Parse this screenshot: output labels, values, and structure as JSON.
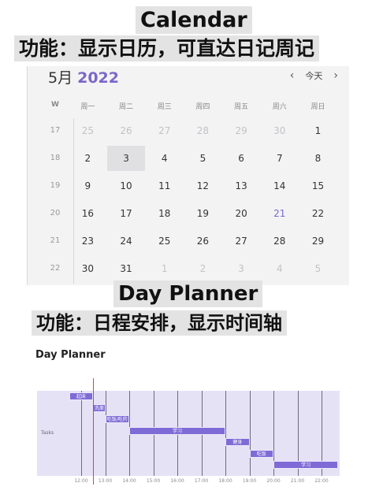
{
  "captions": {
    "title": "Calendar",
    "subtitle": "功能：显示日历，可直达日记周记",
    "title2": "Day Planner",
    "subtitle2": "功能：日程安排，显示时间轴"
  },
  "calendar": {
    "month": "5月",
    "year": "2022",
    "nav": {
      "prev": "‹",
      "today": "今天",
      "next": "›"
    },
    "headers": [
      "W",
      "周一",
      "周二",
      "周三",
      "周四",
      "周五",
      "周六",
      "周日"
    ],
    "rows": [
      {
        "week": "17",
        "days": [
          {
            "d": "25",
            "dim": true
          },
          {
            "d": "26",
            "dim": true
          },
          {
            "d": "27",
            "dim": true
          },
          {
            "d": "28",
            "dim": true
          },
          {
            "d": "29",
            "dim": true
          },
          {
            "d": "30",
            "dim": true
          },
          {
            "d": "1"
          }
        ]
      },
      {
        "week": "18",
        "days": [
          {
            "d": "2"
          },
          {
            "d": "3",
            "sel": true
          },
          {
            "d": "4"
          },
          {
            "d": "5"
          },
          {
            "d": "6"
          },
          {
            "d": "7"
          },
          {
            "d": "8"
          }
        ]
      },
      {
        "week": "19",
        "days": [
          {
            "d": "9"
          },
          {
            "d": "10"
          },
          {
            "d": "11"
          },
          {
            "d": "12"
          },
          {
            "d": "13"
          },
          {
            "d": "14"
          },
          {
            "d": "15"
          }
        ]
      },
      {
        "week": "20",
        "days": [
          {
            "d": "16"
          },
          {
            "d": "17"
          },
          {
            "d": "18"
          },
          {
            "d": "19"
          },
          {
            "d": "20"
          },
          {
            "d": "21",
            "today": true
          },
          {
            "d": "22"
          }
        ]
      },
      {
        "week": "21",
        "days": [
          {
            "d": "23"
          },
          {
            "d": "24"
          },
          {
            "d": "25"
          },
          {
            "d": "26"
          },
          {
            "d": "27"
          },
          {
            "d": "28"
          },
          {
            "d": "29"
          }
        ]
      },
      {
        "week": "22",
        "days": [
          {
            "d": "30"
          },
          {
            "d": "31"
          },
          {
            "d": "1",
            "dim": true
          },
          {
            "d": "2",
            "dim": true
          },
          {
            "d": "3",
            "dim": true
          },
          {
            "d": "4",
            "dim": true
          },
          {
            "d": "5",
            "dim": true
          }
        ]
      }
    ]
  },
  "day_planner": {
    "title": "Day Planner",
    "ylabel": "Tasks",
    "now_time": "12:30",
    "ticks": [
      "12:00",
      "13:00",
      "14:00",
      "15:00",
      "16:00",
      "17:00",
      "18:00",
      "19:00",
      "20:00",
      "21:00",
      "22:00"
    ],
    "tasks": [
      {
        "label": "起床",
        "start": 11.5,
        "end": 12.5
      },
      {
        "label": "洗漱",
        "start": 12.5,
        "end": 13.0
      },
      {
        "label": "吃饭/吃药",
        "start": 13.0,
        "end": 14.0
      },
      {
        "label": "学习",
        "start": 14.0,
        "end": 18.0
      },
      {
        "label": "健身",
        "start": 18.0,
        "end": 19.0
      },
      {
        "label": "吃饭",
        "start": 19.0,
        "end": 20.0
      },
      {
        "label": "学习",
        "start": 20.0,
        "end": 22.7
      }
    ]
  }
}
